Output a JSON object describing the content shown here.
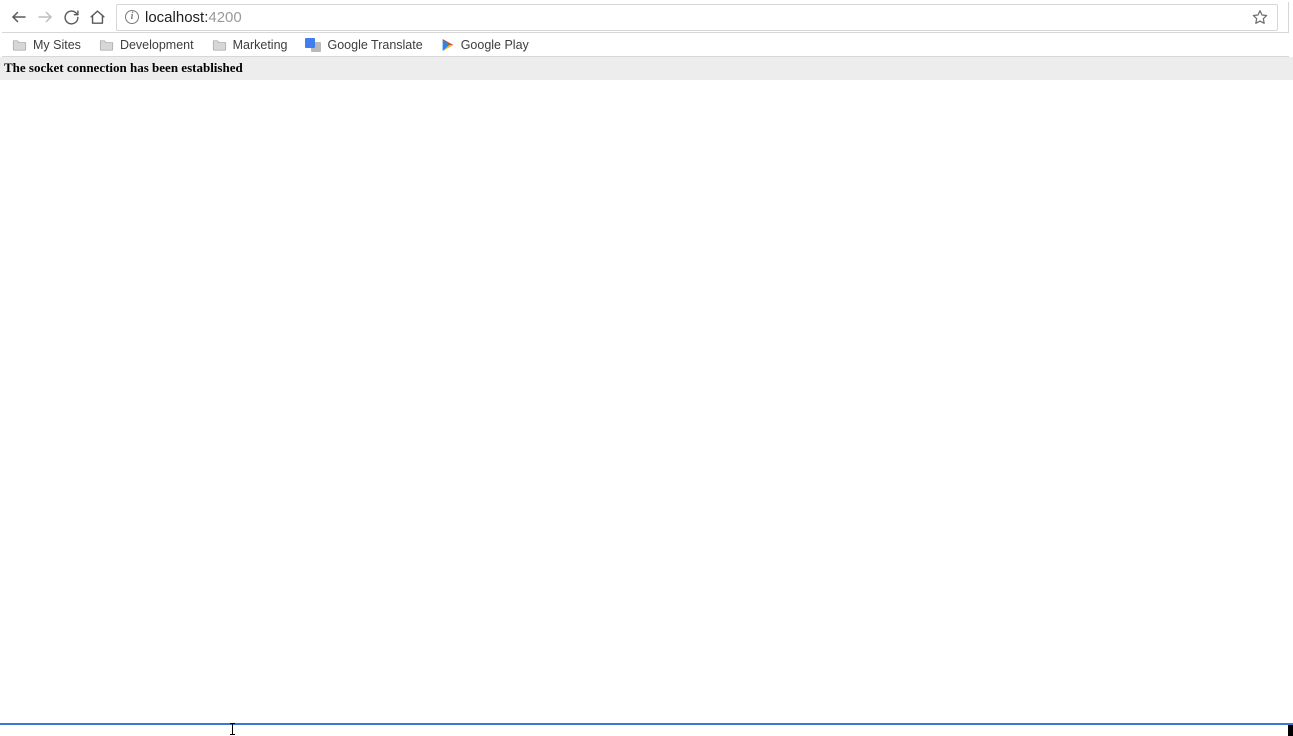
{
  "address": {
    "host": "localhost:",
    "port": "4200"
  },
  "bookmarks": [
    {
      "label": "My Sites",
      "type": "folder"
    },
    {
      "label": "Development",
      "type": "folder"
    },
    {
      "label": "Marketing",
      "type": "folder"
    },
    {
      "label": "Google Translate",
      "type": "translate"
    },
    {
      "label": "Google Play",
      "type": "play"
    }
  ],
  "page": {
    "status_message": "The socket connection has been established"
  }
}
